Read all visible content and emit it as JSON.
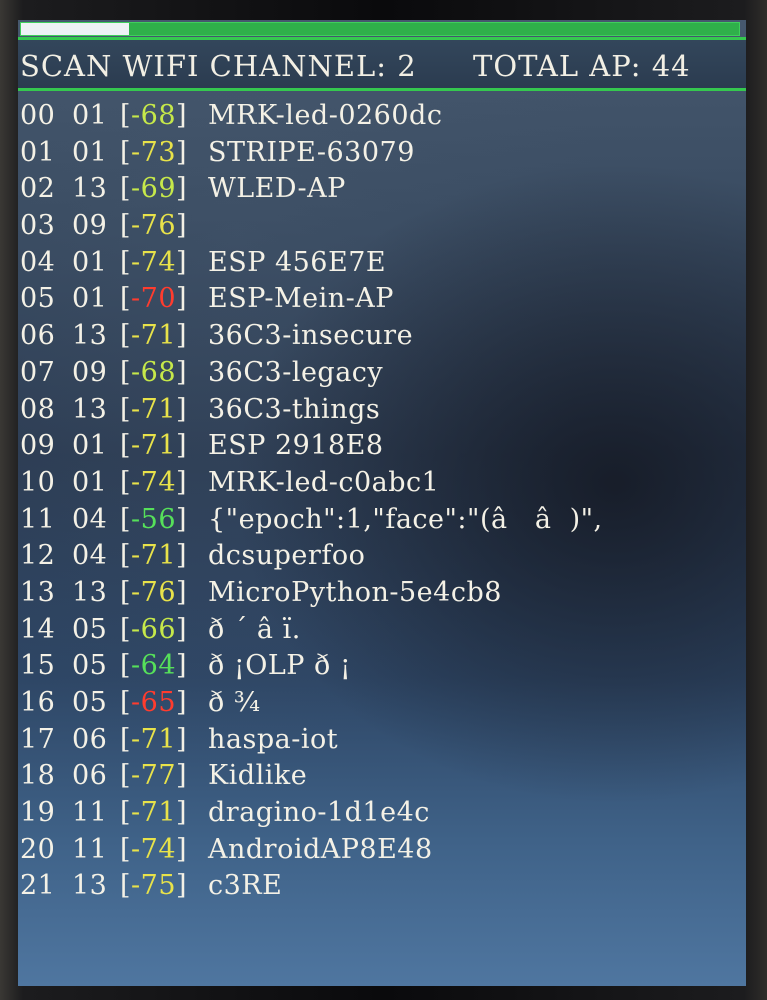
{
  "header": {
    "scan_label": "SCAN WIFI CHANNEL: 2",
    "total_label": "TOTAL AP: 44"
  },
  "progress": {
    "value_percent": 15
  },
  "colors": {
    "text": "#f4f1e6",
    "accent_green": "#35c84f",
    "rssi_yellow": "#e8e24a",
    "rssi_yellow_green": "#c6e84a",
    "rssi_green": "#56e05a",
    "rssi_red": "#ff3c2e"
  },
  "rows": [
    {
      "idx": "00",
      "ch": "01",
      "rssi": "-68",
      "rssi_color": "#c6e84a",
      "ssid": "MRK-led-0260dc"
    },
    {
      "idx": "01",
      "ch": "01",
      "rssi": "-73",
      "rssi_color": "#e8e24a",
      "ssid": "STRIPE-63079"
    },
    {
      "idx": "02",
      "ch": "13",
      "rssi": "-69",
      "rssi_color": "#c6e84a",
      "ssid": "WLED-AP"
    },
    {
      "idx": "03",
      "ch": "09",
      "rssi": "-76",
      "rssi_color": "#e8e24a",
      "ssid": ""
    },
    {
      "idx": "04",
      "ch": "01",
      "rssi": "-74",
      "rssi_color": "#e8e24a",
      "ssid": "ESP 456E7E"
    },
    {
      "idx": "05",
      "ch": "01",
      "rssi": "-70",
      "rssi_color": "#ff3c2e",
      "ssid": "ESP-Mein-AP"
    },
    {
      "idx": "06",
      "ch": "13",
      "rssi": "-71",
      "rssi_color": "#e8e24a",
      "ssid": "36C3-insecure"
    },
    {
      "idx": "07",
      "ch": "09",
      "rssi": "-68",
      "rssi_color": "#c6e84a",
      "ssid": "36C3-legacy"
    },
    {
      "idx": "08",
      "ch": "13",
      "rssi": "-71",
      "rssi_color": "#e8e24a",
      "ssid": "36C3-things"
    },
    {
      "idx": "09",
      "ch": "01",
      "rssi": "-71",
      "rssi_color": "#e8e24a",
      "ssid": "ESP 2918E8"
    },
    {
      "idx": "10",
      "ch": "01",
      "rssi": "-74",
      "rssi_color": "#e8e24a",
      "ssid": "MRK-led-c0abc1"
    },
    {
      "idx": "11",
      "ch": "04",
      "rssi": "-56",
      "rssi_color": "#56e05a",
      "ssid": "{\"epoch\":1,\"face\":\"(â   â  )\","
    },
    {
      "idx": "12",
      "ch": "04",
      "rssi": "-71",
      "rssi_color": "#e8e24a",
      "ssid": "dcsuperfoo"
    },
    {
      "idx": "13",
      "ch": "13",
      "rssi": "-76",
      "rssi_color": "#e8e24a",
      "ssid": "MicroPython-5e4cb8"
    },
    {
      "idx": "14",
      "ch": "05",
      "rssi": "-66",
      "rssi_color": "#c6e84a",
      "ssid": "ð ´ â ï."
    },
    {
      "idx": "15",
      "ch": "05",
      "rssi": "-64",
      "rssi_color": "#56e05a",
      "ssid": "ð ¡OLP ð ¡"
    },
    {
      "idx": "16",
      "ch": "05",
      "rssi": "-65",
      "rssi_color": "#ff3c2e",
      "ssid": "ð ¾"
    },
    {
      "idx": "17",
      "ch": "06",
      "rssi": "-71",
      "rssi_color": "#e8e24a",
      "ssid": "haspa-iot"
    },
    {
      "idx": "18",
      "ch": "06",
      "rssi": "-77",
      "rssi_color": "#e8e24a",
      "ssid": "Kidlike"
    },
    {
      "idx": "19",
      "ch": "11",
      "rssi": "-71",
      "rssi_color": "#e8e24a",
      "ssid": "dragino-1d1e4c"
    },
    {
      "idx": "20",
      "ch": "11",
      "rssi": "-74",
      "rssi_color": "#e8e24a",
      "ssid": "AndroidAP8E48"
    },
    {
      "idx": "21",
      "ch": "13",
      "rssi": "-75",
      "rssi_color": "#e8e24a",
      "ssid": "c3RE"
    }
  ]
}
